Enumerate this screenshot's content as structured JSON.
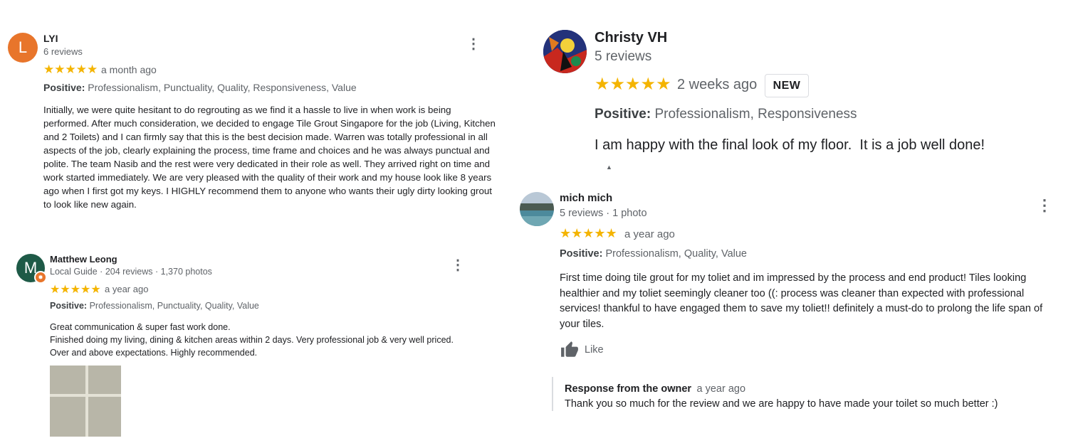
{
  "reviews": [
    {
      "initial": "L",
      "avatar_color": "#e8752b",
      "name": "LYI",
      "meta": "6 reviews",
      "stars": "★★★★★",
      "time": "a month ago",
      "positive_label": "Positive:",
      "positive_values": " Professionalism, Punctuality, Quality, Responsiveness, Value",
      "text": "Initially, we were quite hesitant to do regrouting as we find it a hassle to live in when work is being performed. After much consideration, we decided to engage Tile Grout Singapore for the job (Living, Kitchen and 2 Toilets) and I can firmly say that this is the best decision made. Warren was totally professional in all aspects of the job, clearly explaining the process, time frame and choices and he was always punctual and polite. The team Nasib and the rest were very dedicated in their role as well. They arrived right on time and work started immediately. We are very pleased with the quality of their work and my house look like 8 years ago when I first got my keys. I HIGHLY recommend them to anyone who wants their ugly dirty looking grout to look like new again."
    },
    {
      "initial": "M",
      "avatar_color": "#1e5a47",
      "name": "Matthew Leong",
      "meta": "Local Guide · 204 reviews · 1,370 photos",
      "stars": "★★★★★",
      "time": "a year ago",
      "positive_label": "Positive:",
      "positive_values": " Professionalism, Punctuality, Quality, Value",
      "text_lines": [
        "Great communication & super fast work done.",
        "Finished doing my living, dining & kitchen areas within 2 days. Very professional job & very well priced.",
        "Over and above expectations. Highly recommended."
      ]
    },
    {
      "name": "Christy VH",
      "meta": "5 reviews",
      "stars": "★★★★★",
      "time": "2 weeks ago",
      "badge": "NEW",
      "positive_label": "Positive:",
      "positive_values": " Professionalism, Responsiveness",
      "text": "I am happy with the final look of my floor.  It is a job well done!"
    },
    {
      "name": "mich mich",
      "meta": "5 reviews · 1 photo",
      "stars": "★★★★★",
      "time": "a year ago",
      "positive_label": "Positive:",
      "positive_values": " Professionalism, Quality, Value",
      "text": "First time doing tile grout for my toliet and im impressed by the process and end product! Tiles looking healthier and my toliet seemingly cleaner too ((: process was cleaner than expected with professional services! thankful to have engaged them to save my toliet!! definitely a must-do to prolong the life span of your tiles.",
      "like_label": "Like",
      "owner_response_label": "Response from the owner",
      "owner_response_time": "a year ago",
      "owner_response_text": "Thank you so much for the review and we are happy to have made your toilet so much better :)"
    }
  ],
  "icons": {
    "more_options": "more-vert-icon",
    "thumbs_up": "thumb-up-icon",
    "local_guide_badge": "local-guide-badge-icon"
  }
}
